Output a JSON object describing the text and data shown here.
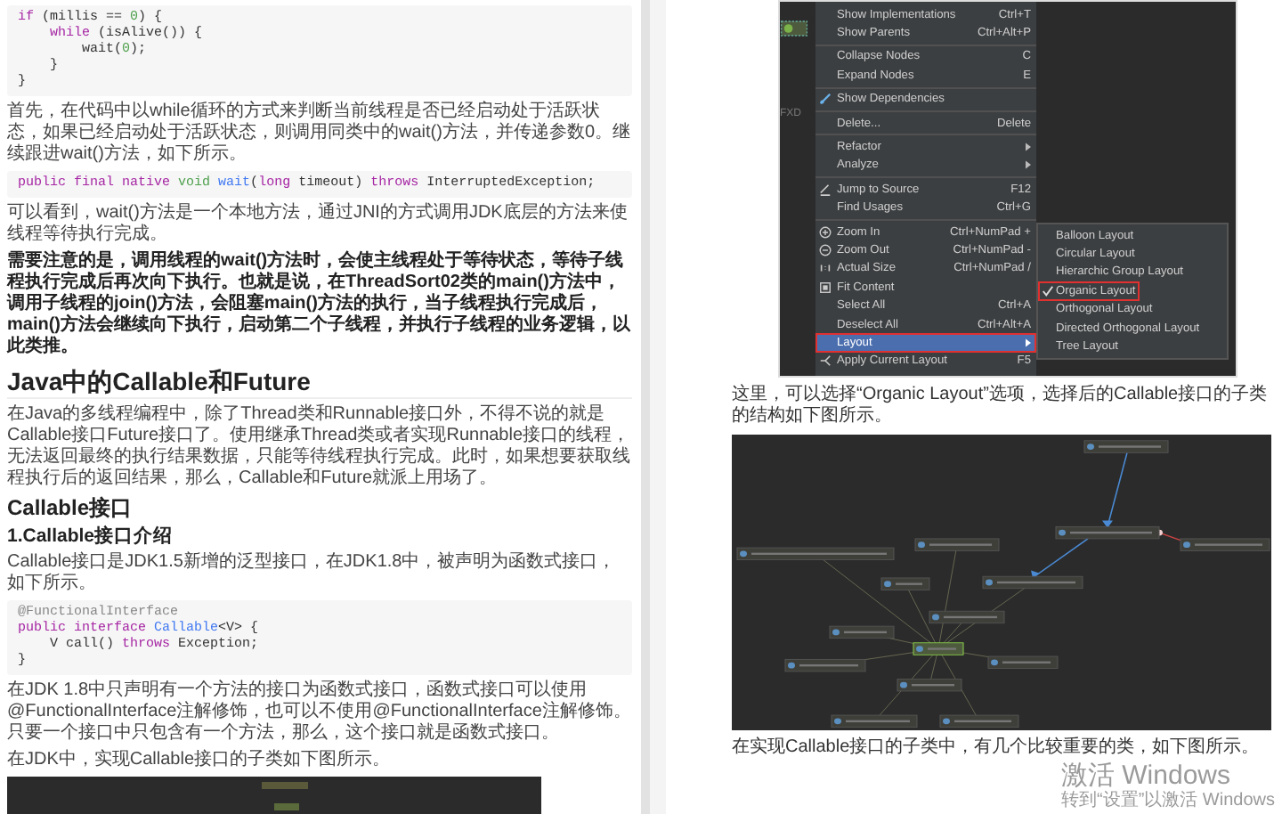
{
  "left_page": {
    "blocks": [
      {
        "kind": "code",
        "lines": [
          [
            {
              "text": "if",
              "kind": "keyword"
            },
            {
              "text": " (millis == ",
              "kind": "plain"
            },
            {
              "text": "0",
              "kind": "number"
            },
            {
              "text": ") {",
              "kind": "plain"
            }
          ],
          [
            {
              "text": "    while",
              "kind": "keyword"
            },
            {
              "text": " (isAlive()) {",
              "kind": "plain"
            }
          ],
          [
            {
              "text": "        wait(",
              "kind": "plain"
            },
            {
              "text": "0",
              "kind": "number"
            },
            {
              "text": ");",
              "kind": "plain"
            }
          ],
          [
            {
              "text": "    }",
              "kind": "plain"
            }
          ],
          [
            {
              "text": "}",
              "kind": "plain"
            }
          ]
        ]
      },
      {
        "kind": "paragraph",
        "text": "首先，在代码中以while循环的方式来判断当前线程是否已经启动处于活跃状态，如果已经启动处于活跃状态，则调用同类中的wait()方法，并传递参数0。继续跟进wait()方法，如下所示。"
      },
      {
        "kind": "code",
        "lines": [
          [
            {
              "text": "public final native",
              "kind": "keyword"
            },
            {
              "text": " void",
              "kind": "type"
            },
            {
              "text": " wait",
              "kind": "function"
            },
            {
              "text": "(",
              "kind": "plain"
            },
            {
              "text": "long",
              "kind": "keyword"
            },
            {
              "text": " timeout) ",
              "kind": "plain"
            },
            {
              "text": "throws",
              "kind": "keyword"
            },
            {
              "text": " InterruptedException;",
              "kind": "plain"
            }
          ]
        ]
      },
      {
        "kind": "paragraph",
        "text": "可以看到，wait()方法是一个本地方法，通过JNI的方式调用JDK底层的方法来使线程等待执行完成。"
      },
      {
        "kind": "strong_paragraph",
        "text": "需要注意的是，调用线程的wait()方法时，会使主线程处于等待状态，等待子线程执行完成后再次向下执行。也就是说，在ThreadSort02类的main()方法中，调用子线程的join()方法，会阻塞main()方法的执行，当子线程执行完成后，main()方法会继续向下执行，启动第二个子线程，并执行子线程的业务逻辑，以此类推。"
      },
      {
        "kind": "h2",
        "text": "Java中的Callable和Future"
      },
      {
        "kind": "paragraph",
        "text": "在Java的多线程编程中，除了Thread类和Runnable接口外，不得不说的就是Callable接口Future接口了。使用继承Thread类或者实现Runnable接口的线程，无法返回最终的执行结果数据，只能等待线程执行完成。此时，如果想要获取线程执行后的返回结果，那么，Callable和Future就派上用场了。"
      },
      {
        "kind": "h3",
        "text": "Callable接口"
      },
      {
        "kind": "h4",
        "text": "1.Callable接口介绍"
      },
      {
        "kind": "paragraph",
        "text": "Callable接口是JDK1.5新增的泛型接口，在JDK1.8中，被声明为函数式接口，如下所示。"
      },
      {
        "kind": "code",
        "lines": [
          [
            {
              "text": "@FunctionalInterface",
              "kind": "annotation"
            }
          ],
          [
            {
              "text": "public interface",
              "kind": "keyword"
            },
            {
              "text": " Callable",
              "kind": "function"
            },
            {
              "text": "<V> {",
              "kind": "plain"
            }
          ],
          [
            {
              "text": "    V call() ",
              "kind": "plain"
            },
            {
              "text": "throws",
              "kind": "keyword"
            },
            {
              "text": " Exception;",
              "kind": "plain"
            }
          ],
          [
            {
              "text": "}",
              "kind": "plain"
            }
          ]
        ]
      },
      {
        "kind": "paragraph",
        "text": "在JDK 1.8中只声明有一个方法的接口为函数式接口，函数式接口可以使用@FunctionalInterface注解修饰，也可以不使用@FunctionalInterface注解修饰。只要一个接口中只包含有一个方法，那么，这个接口就是函数式接口。"
      },
      {
        "kind": "paragraph",
        "text": "在JDK中，实现Callable接口的子类如下图所示。"
      },
      {
        "kind": "hierarchy_image"
      }
    ]
  },
  "right_page": {
    "menu_screenshot": {
      "partial_label": "FXD",
      "groups": [
        [
          {
            "label": "Show Implementations",
            "shortcut": "Ctrl+T",
            "has_submenu": false,
            "selected": false,
            "outlined": false
          },
          {
            "label": "Show Parents",
            "shortcut": "Ctrl+Alt+P",
            "has_submenu": false,
            "selected": false,
            "outlined": false
          }
        ],
        [
          {
            "label": "Collapse Nodes",
            "shortcut": "C",
            "has_submenu": false,
            "selected": false,
            "outlined": false
          },
          {
            "label": "Expand Nodes",
            "shortcut": "E",
            "has_submenu": false,
            "selected": false,
            "outlined": false
          }
        ],
        [
          {
            "label": "Show Dependencies",
            "has_submenu": false,
            "selected": false,
            "outlined": false
          }
        ],
        [
          {
            "label": "Delete...",
            "shortcut": "Delete",
            "has_submenu": false,
            "selected": false,
            "outlined": false
          }
        ],
        [
          {
            "label": "Refactor",
            "has_submenu": true,
            "selected": false,
            "outlined": false
          },
          {
            "label": "Analyze",
            "has_submenu": true,
            "selected": false,
            "outlined": false
          }
        ],
        [
          {
            "label": "Jump to Source",
            "shortcut": "F12",
            "has_submenu": false,
            "selected": false,
            "outlined": false
          },
          {
            "label": "Find Usages",
            "shortcut": "Ctrl+G",
            "has_submenu": false,
            "selected": false,
            "outlined": false
          }
        ],
        [
          {
            "label": "Zoom In",
            "shortcut": "Ctrl+NumPad +",
            "has_submenu": false,
            "selected": false,
            "outlined": false
          },
          {
            "label": "Zoom Out",
            "shortcut": "Ctrl+NumPad -",
            "has_submenu": false,
            "selected": false,
            "outlined": false
          },
          {
            "label": "Actual Size",
            "shortcut": "Ctrl+NumPad /",
            "has_submenu": false,
            "selected": false,
            "outlined": false
          },
          {
            "label": "Fit Content",
            "has_submenu": false,
            "selected": false,
            "outlined": false
          },
          {
            "label": "Select All",
            "shortcut": "Ctrl+A",
            "has_submenu": false,
            "selected": false,
            "outlined": false
          },
          {
            "label": "Deselect All",
            "shortcut": "Ctrl+Alt+A",
            "has_submenu": false,
            "selected": false,
            "outlined": false
          },
          {
            "label": "Layout",
            "has_submenu": true,
            "selected": true,
            "outlined": true
          },
          {
            "label": "Apply Current Layout",
            "shortcut": "F5",
            "has_submenu": false,
            "selected": false,
            "outlined": false
          }
        ]
      ],
      "submenu": [
        {
          "label": "Balloon Layout",
          "checked": false,
          "outlined": false
        },
        {
          "label": "Circular Layout",
          "checked": false,
          "outlined": false
        },
        {
          "label": "Hierarchic Group Layout",
          "checked": false,
          "outlined": false
        },
        {
          "label": "Organic Layout",
          "checked": true,
          "outlined": true
        },
        {
          "label": "Orthogonal Layout",
          "checked": false,
          "outlined": false
        },
        {
          "label": "Directed Orthogonal Layout",
          "checked": false,
          "outlined": false
        },
        {
          "label": "Tree Layout",
          "checked": false,
          "outlined": false
        }
      ]
    },
    "caption_1": "这里，可以选择“Organic Layout”选项，选择后的Callable接口的子类的结构如下图所示。",
    "caption_2": "在实现Callable接口的子类中，有几个比较重要的类，如下图所示。"
  },
  "activation_notice": {
    "title": "激活 Windows",
    "subtitle": "转到“设置”以激活 Windows"
  }
}
